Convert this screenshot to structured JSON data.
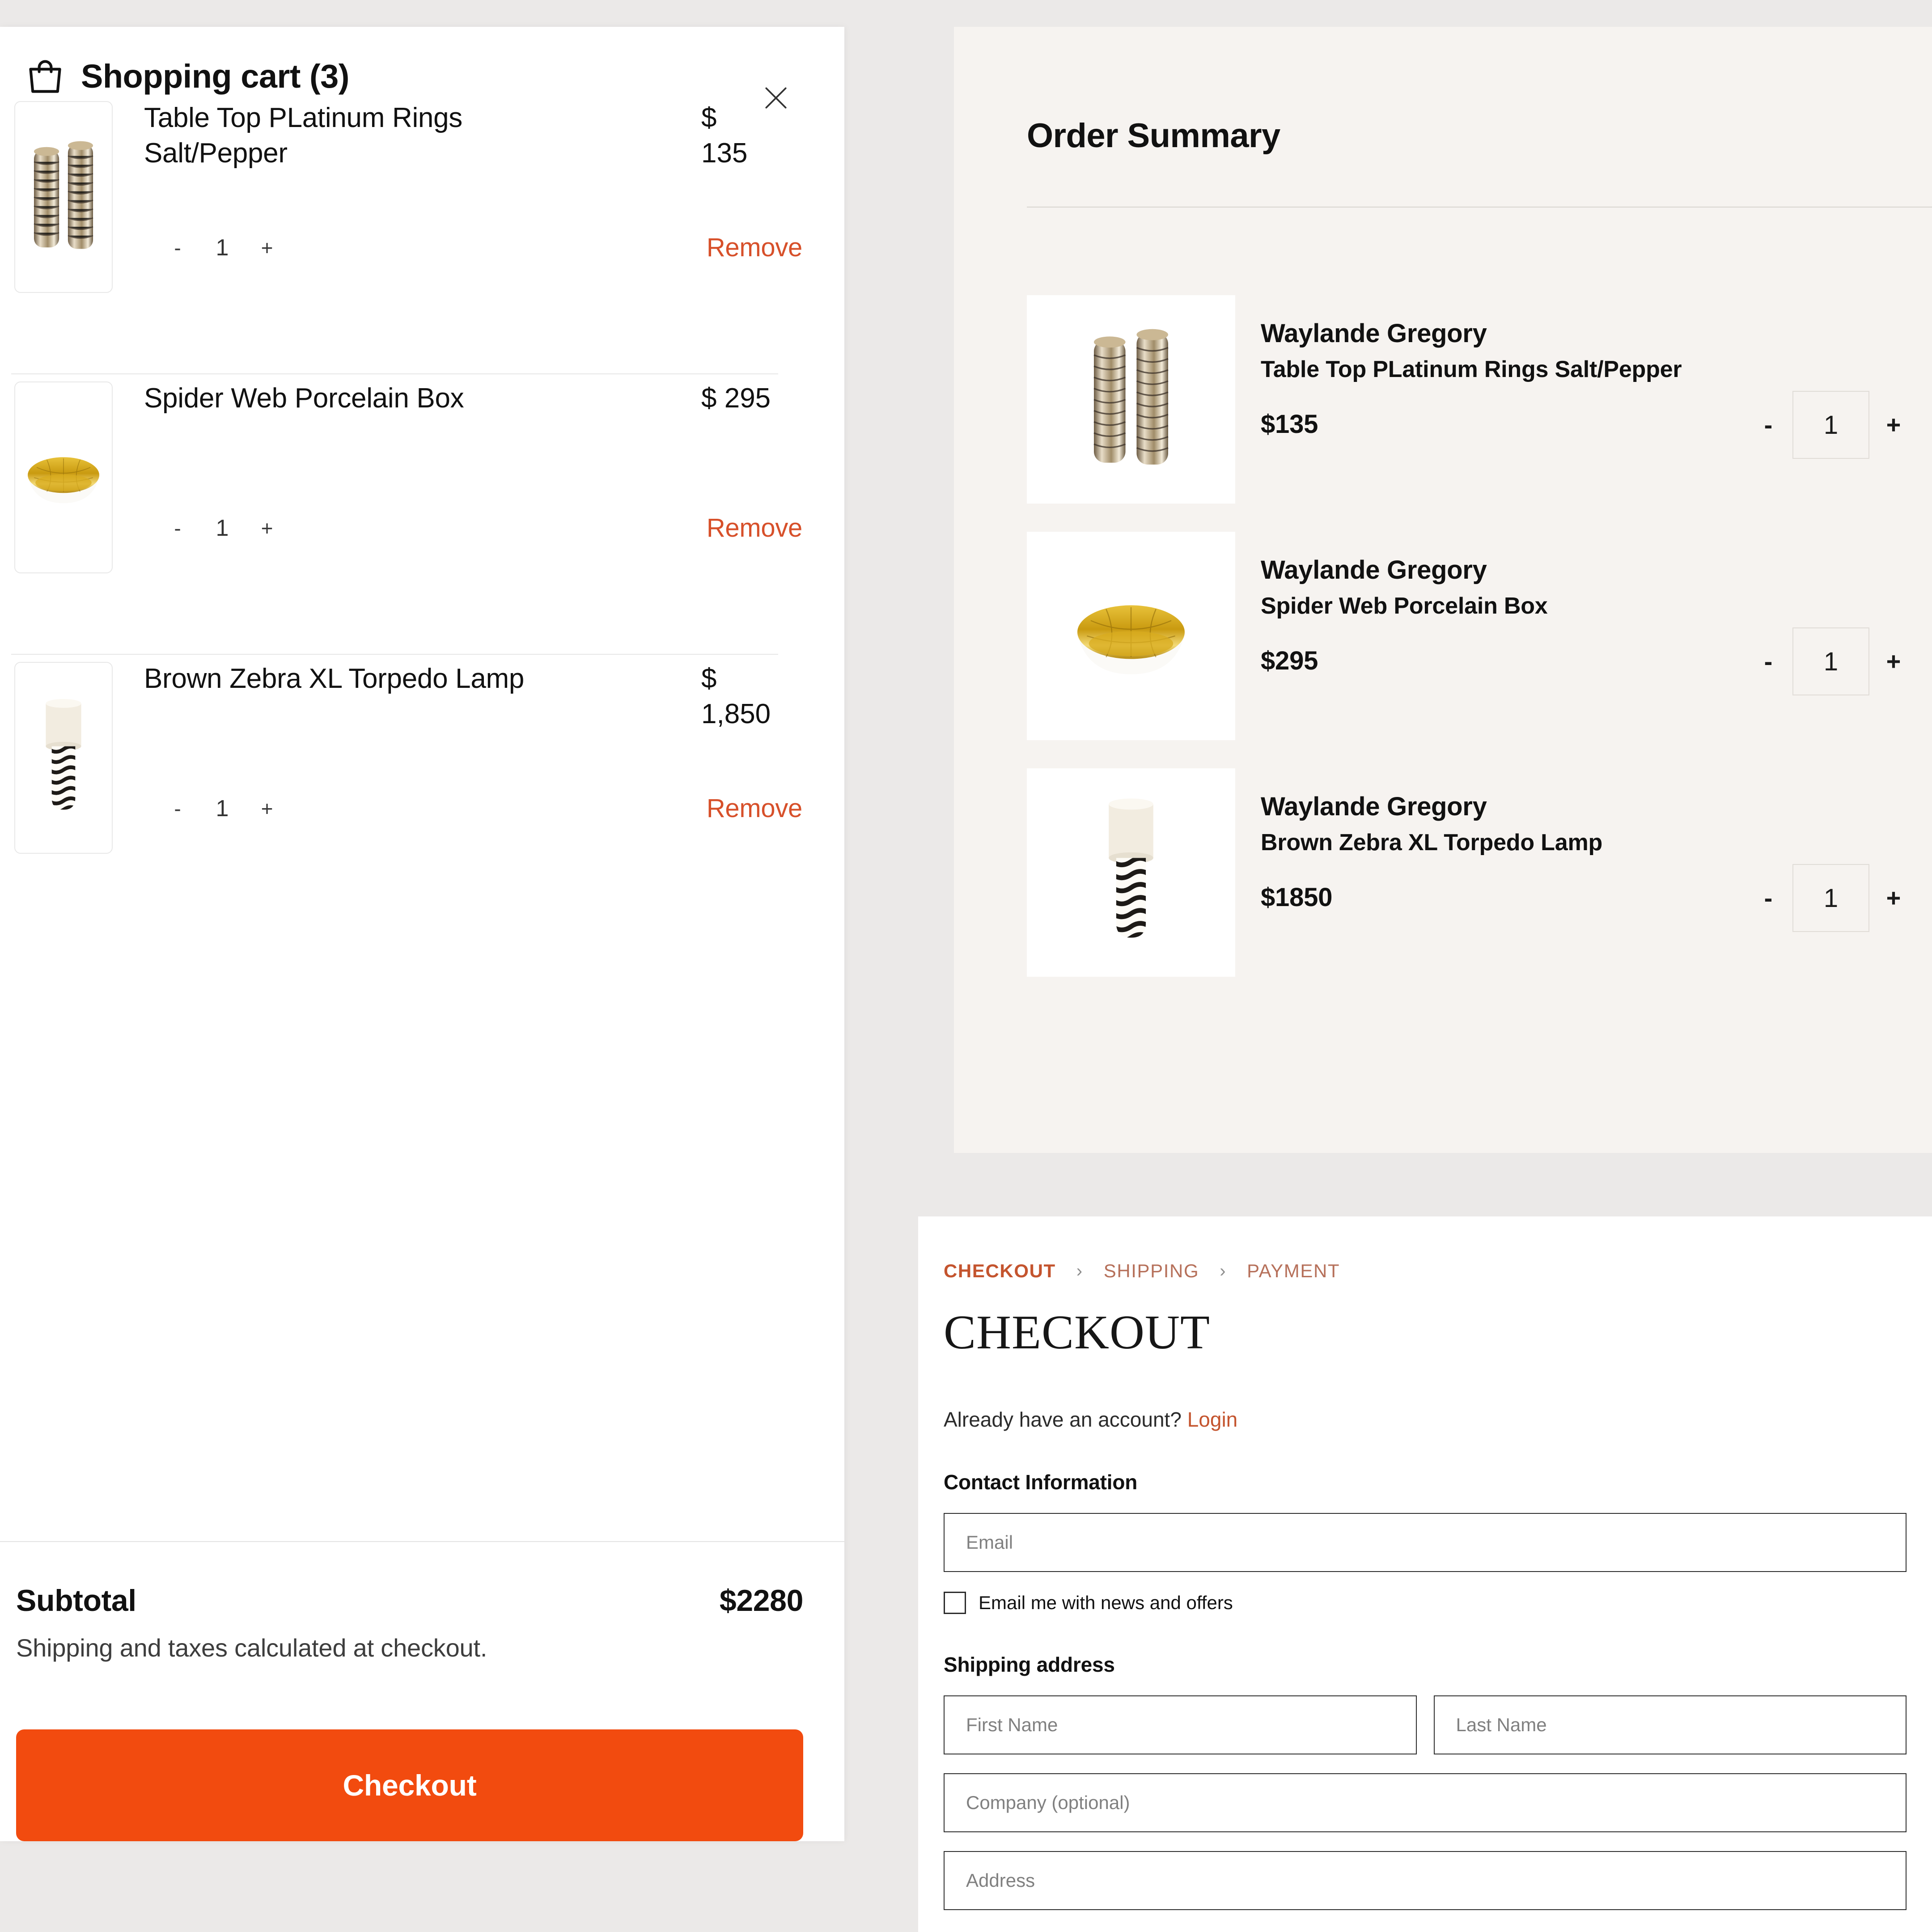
{
  "cart": {
    "title": "Shopping cart (3)",
    "bag_icon": "shopping-bag-icon",
    "close_icon": "close-icon",
    "items": [
      {
        "name": "Table Top PLatinum Rings Salt/Pepper",
        "currency": "$",
        "price": "135",
        "qty": "1",
        "minus": "-",
        "plus": "+",
        "remove": "Remove",
        "image": "salt-pepper-shakers"
      },
      {
        "name": "Spider Web Porcelain Box",
        "currency": "$",
        "price": "295",
        "qty": "1",
        "minus": "-",
        "plus": "+",
        "remove": "Remove",
        "image": "gold-porcelain-box"
      },
      {
        "name": "Brown Zebra XL Torpedo Lamp",
        "currency": "$",
        "price": "1,850",
        "qty": "1",
        "minus": "-",
        "plus": "+",
        "remove": "Remove",
        "image": "zebra-torpedo-lamp"
      }
    ],
    "subtotal_label": "Subtotal",
    "subtotal_value": "$2280",
    "subtotal_note": "Shipping and taxes calculated at checkout.",
    "checkout_button": "Checkout"
  },
  "order_summary": {
    "title": "Order Summary",
    "items": [
      {
        "brand": "Waylande Gregory",
        "name": "Table Top PLatinum Rings Salt/Pepper",
        "price": "$135",
        "qty": "1",
        "minus": "-",
        "plus": "+",
        "image": "salt-pepper-shakers"
      },
      {
        "brand": "Waylande Gregory",
        "name": "Spider Web Porcelain Box",
        "price": "$295",
        "qty": "1",
        "minus": "-",
        "plus": "+",
        "image": "gold-porcelain-box"
      },
      {
        "brand": "Waylande Gregory",
        "name": "Brown Zebra XL Torpedo Lamp",
        "price": "$1850",
        "qty": "1",
        "minus": "-",
        "plus": "+",
        "image": "zebra-torpedo-lamp"
      }
    ]
  },
  "checkout": {
    "breadcrumb": {
      "step1": "CHECKOUT",
      "sep1": "›",
      "step2": "SHIPPING",
      "sep2": "›",
      "step3": "PAYMENT"
    },
    "heading": "CHECKOUT",
    "account_prompt": "Already have an account?",
    "login_link": "Login",
    "contact_title": "Contact Information",
    "email_placeholder": "Email",
    "optin_label": "Email me with news and offers",
    "shipping_title": "Shipping address",
    "first_name_placeholder": "First Name",
    "last_name_placeholder": "Last Name",
    "company_placeholder": "Company (optional)",
    "address_placeholder": "Address"
  },
  "colors": {
    "accent_orange": "#f24b0f",
    "link_rust": "#c4542e",
    "remove_red": "#d7502a",
    "page_bg": "#ebe9e8",
    "summary_bg": "#f6f3f0"
  }
}
